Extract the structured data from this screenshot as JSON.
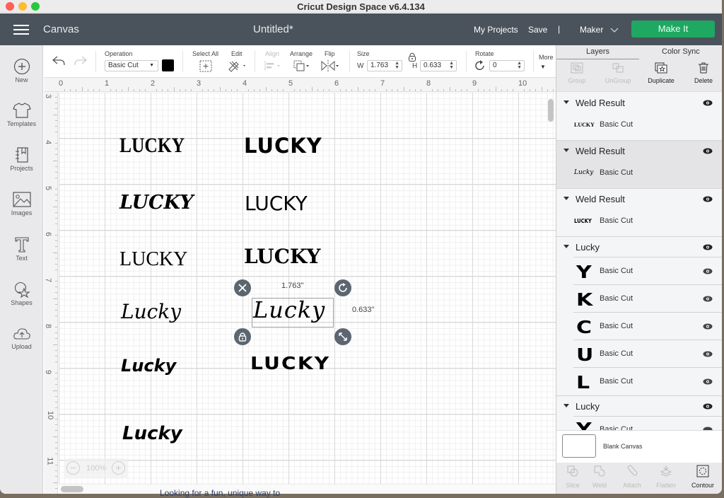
{
  "window": {
    "title": "Cricut Design Space  v6.4.134"
  },
  "appbar": {
    "section": "Canvas",
    "document_title": "Untitled*",
    "my_projects": "My Projects",
    "save": "Save",
    "separator": "|",
    "machine": "Maker",
    "make_it": "Make It",
    "accent": "#1fa862"
  },
  "leftbar": {
    "items": [
      {
        "label": "New",
        "icon": "plus-circle-icon"
      },
      {
        "label": "Templates",
        "icon": "tshirt-icon"
      },
      {
        "label": "Projects",
        "icon": "notebook-icon"
      },
      {
        "label": "Images",
        "icon": "image-icon"
      },
      {
        "label": "Text",
        "icon": "text-t-icon"
      },
      {
        "label": "Shapes",
        "icon": "shapes-icon"
      },
      {
        "label": "Upload",
        "icon": "cloud-upload-icon"
      }
    ]
  },
  "toolbar": {
    "operation_label": "Operation",
    "operation_value": "Basic Cut",
    "operation_color": "#000000",
    "select_all": "Select All",
    "edit": "Edit",
    "align": "Align",
    "arrange": "Arrange",
    "flip": "Flip",
    "size_label": "Size",
    "w_label": "W",
    "w_value": "1.763",
    "h_label": "H",
    "h_value": "0.633",
    "rotate_label": "Rotate",
    "rotate_value": "0",
    "more": "More"
  },
  "rulers": {
    "top": [
      "0",
      "1",
      "2",
      "3",
      "4",
      "5",
      "6",
      "7",
      "8",
      "9",
      "10"
    ],
    "left": [
      "3",
      "4",
      "5",
      "6",
      "7",
      "8",
      "9",
      "10",
      "11"
    ]
  },
  "canvas": {
    "texts": [
      "LUCKY",
      "LUCKY",
      "LUCKY",
      "LUCKY",
      "LUCKY",
      "LUCKY",
      "Lucky",
      "Lucky",
      "Lucky",
      "LUCKY",
      "Lucky"
    ],
    "selection": {
      "width_label": "1.763\"",
      "height_label": "0.633\""
    },
    "zoom": "100%",
    "zoom_out": "−",
    "zoom_in": "+"
  },
  "panel": {
    "tabs": [
      "Layers",
      "Color Sync"
    ],
    "actions": [
      {
        "label": "Group",
        "enabled": false
      },
      {
        "label": "UnGroup",
        "enabled": false
      },
      {
        "label": "Duplicate",
        "enabled": true
      },
      {
        "label": "Delete",
        "enabled": true
      }
    ],
    "groups": [
      {
        "name": "Weld Result",
        "thumb": "LUCKY",
        "op": "Basic Cut"
      },
      {
        "name": "Weld Result",
        "thumb": "Lucky",
        "op": "Basic Cut"
      },
      {
        "name": "Weld Result",
        "thumb": "LUCKY",
        "op": "Basic Cut"
      }
    ],
    "lucky_group": {
      "name": "Lucky",
      "letters": [
        {
          "glyph": "Y",
          "op": "Basic Cut"
        },
        {
          "glyph": "K",
          "op": "Basic Cut"
        },
        {
          "glyph": "C",
          "op": "Basic Cut"
        },
        {
          "glyph": "U",
          "op": "Basic Cut"
        },
        {
          "glyph": "L",
          "op": "Basic Cut"
        }
      ]
    },
    "lucky_group2": {
      "name": "Lucky",
      "glyph": "Y",
      "op": "Basic Cut"
    },
    "blank_canvas": "Blank Canvas",
    "bottom": [
      {
        "label": "Slice",
        "enabled": false
      },
      {
        "label": "Weld",
        "enabled": false
      },
      {
        "label": "Attach",
        "enabled": false
      },
      {
        "label": "Flatten",
        "enabled": false
      },
      {
        "label": "Contour",
        "enabled": true
      }
    ]
  },
  "background_peek": "Looking for a fun, unique way to"
}
